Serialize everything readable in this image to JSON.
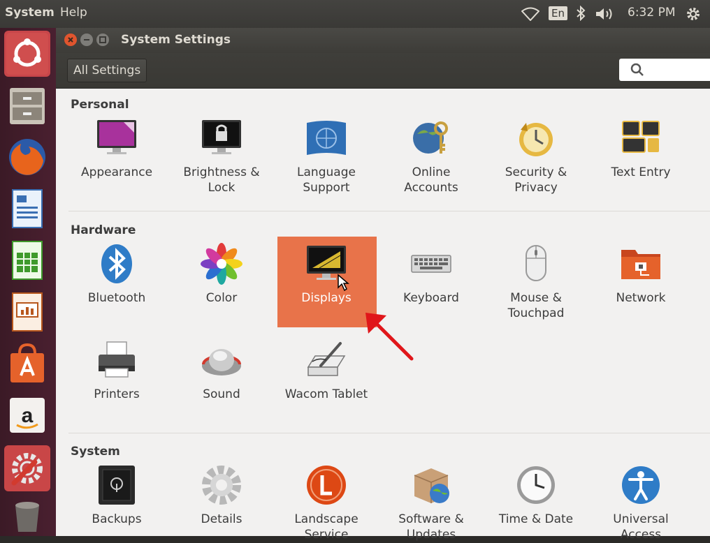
{
  "topbar": {
    "menu_system": "System",
    "menu_help": "Help",
    "keyboard_layout": "En",
    "clock": "6:32 PM"
  },
  "window": {
    "title": "System Settings",
    "all_settings": "All Settings",
    "search_placeholder": ""
  },
  "sections": {
    "personal": "Personal",
    "hardware": "Hardware",
    "system": "System"
  },
  "personal_items": [
    {
      "label1": "Appearance",
      "label2": ""
    },
    {
      "label1": "Brightness &",
      "label2": "Lock"
    },
    {
      "label1": "Language",
      "label2": "Support"
    },
    {
      "label1": "Online",
      "label2": "Accounts"
    },
    {
      "label1": "Security &",
      "label2": "Privacy"
    },
    {
      "label1": "Text Entry",
      "label2": ""
    }
  ],
  "hardware_items": [
    {
      "label1": "Bluetooth",
      "label2": ""
    },
    {
      "label1": "Color",
      "label2": ""
    },
    {
      "label1": "Displays",
      "label2": ""
    },
    {
      "label1": "Keyboard",
      "label2": ""
    },
    {
      "label1": "Mouse &",
      "label2": "Touchpad"
    },
    {
      "label1": "Network",
      "label2": ""
    },
    {
      "label1": "Printers",
      "label2": ""
    },
    {
      "label1": "Sound",
      "label2": ""
    },
    {
      "label1": "Wacom Tablet",
      "label2": ""
    }
  ],
  "system_items": [
    {
      "label1": "Backups",
      "label2": ""
    },
    {
      "label1": "Details",
      "label2": ""
    },
    {
      "label1": "Landscape",
      "label2": "Service"
    },
    {
      "label1": "Software &",
      "label2": "Updates"
    },
    {
      "label1": "Time & Date",
      "label2": ""
    },
    {
      "label1": "Universal",
      "label2": "Access"
    }
  ],
  "colors": {
    "selection": "#e8734a",
    "launcher": "#4a2030",
    "arrow": "#e0161a"
  }
}
